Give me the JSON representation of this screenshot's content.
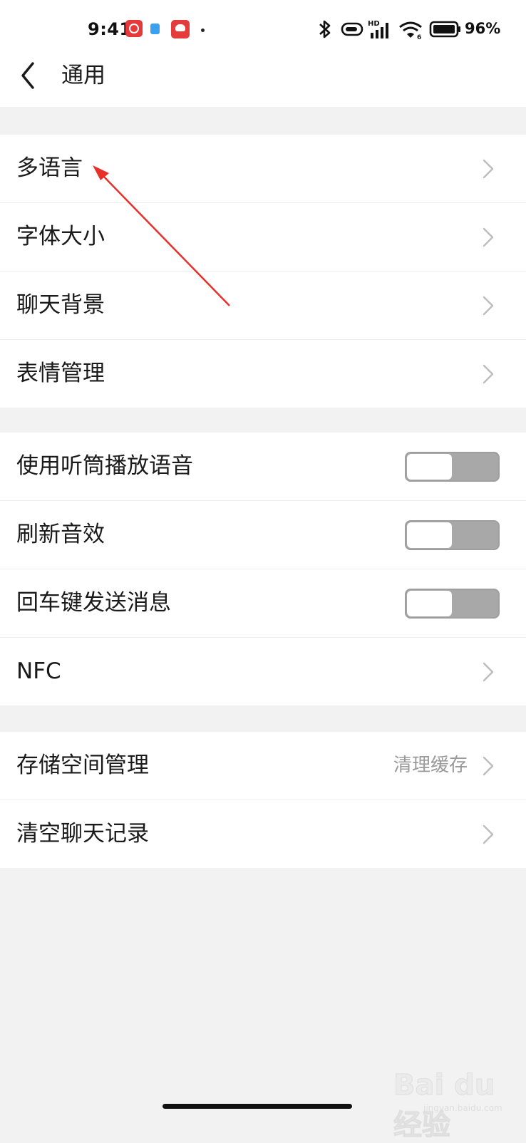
{
  "status_bar": {
    "time": "9:41",
    "battery_percent": "96%",
    "network_label": "HD",
    "wifi_label": "6",
    "icons": [
      "netease-music-icon",
      "blue-app-icon",
      "red-app-icon",
      "notification-dot",
      "bluetooth-icon",
      "vibrate-icon",
      "cellular-signal-icon",
      "wifi-icon",
      "battery-icon"
    ]
  },
  "header": {
    "title": "通用",
    "back_icon": "chevron-left-icon"
  },
  "groups": {
    "display": {
      "items": [
        {
          "label": "多语言"
        },
        {
          "label": "字体大小"
        },
        {
          "label": "聊天背景"
        },
        {
          "label": "表情管理"
        }
      ]
    },
    "sound": {
      "items": [
        {
          "label": "使用听筒播放语音",
          "toggle": "off"
        },
        {
          "label": "刷新音效",
          "toggle": "off"
        },
        {
          "label": "回车键发送消息",
          "toggle": "off"
        },
        {
          "label": "NFC"
        }
      ]
    },
    "storage": {
      "items": [
        {
          "label": "存储空间管理",
          "value": "清理缓存"
        },
        {
          "label": "清空聊天记录"
        }
      ]
    }
  },
  "annotation": {
    "color": "#e8302a"
  },
  "watermark": {
    "text": "Bai du 经验",
    "url": "jingyan.baidu.com"
  },
  "colors": {
    "background": "#f2f2f2",
    "toggle_track": "#a8a8a8",
    "annotation_arrow": "#e8302a"
  }
}
